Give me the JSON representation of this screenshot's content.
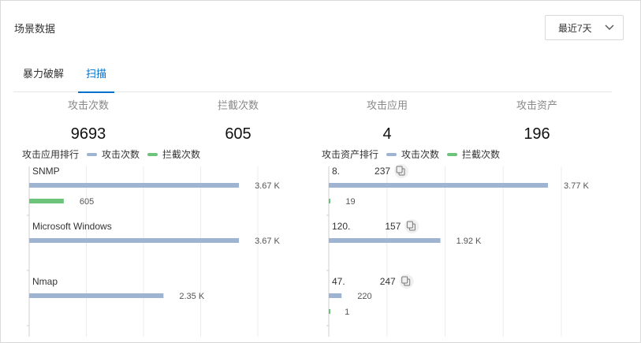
{
  "header": {
    "title": "场景数据",
    "range": "最近7天"
  },
  "tabs": [
    {
      "label": "暴力破解",
      "active": false
    },
    {
      "label": "扫描",
      "active": true
    }
  ],
  "stats": [
    {
      "label": "攻击次数",
      "value": "9693"
    },
    {
      "label": "拦截次数",
      "value": "605"
    },
    {
      "label": "攻击应用",
      "value": "4"
    },
    {
      "label": "攻击资产",
      "value": "196"
    }
  ],
  "colors": {
    "attack": "#9fb4d1",
    "block": "#6cc47a",
    "accent": "#0070cc"
  },
  "app_ranking": {
    "title": "攻击应用排行",
    "legend": [
      "攻击次数",
      "拦截次数"
    ]
  },
  "asset_ranking": {
    "title": "攻击资产排行",
    "legend": [
      "攻击次数",
      "拦截次数"
    ],
    "copy_icon": "copy-icon"
  },
  "chart_data": [
    {
      "type": "bar",
      "title": "攻击应用排行",
      "orientation": "horizontal",
      "categories": [
        "SNMP",
        "Microsoft Windows",
        "Nmap"
      ],
      "series": [
        {
          "name": "攻击次数",
          "values": [
            3670,
            3670,
            2350
          ],
          "labels": [
            "3.67 K",
            "3.67 K",
            "2.35 K"
          ]
        },
        {
          "name": "拦截次数",
          "values": [
            605,
            0,
            0
          ],
          "labels": [
            "605",
            "",
            ""
          ]
        }
      ],
      "xlim": [
        0,
        4000
      ]
    },
    {
      "type": "bar",
      "title": "攻击资产排行",
      "orientation": "horizontal",
      "categories": [
        "8.",
        "120.",
        "47."
      ],
      "category_suffix": [
        "237",
        "157",
        "247"
      ],
      "series": [
        {
          "name": "攻击次数",
          "values": [
            3770,
            1920,
            220
          ],
          "labels": [
            "3.77 K",
            "1.92 K",
            "220"
          ]
        },
        {
          "name": "拦截次数",
          "values": [
            19,
            0,
            1
          ],
          "labels": [
            "19",
            "",
            "1"
          ]
        }
      ],
      "xlim": [
        0,
        4000
      ]
    }
  ]
}
